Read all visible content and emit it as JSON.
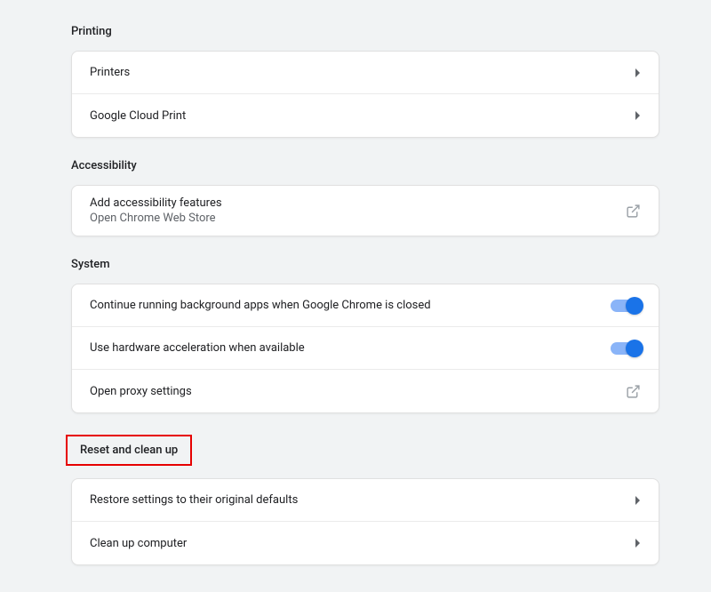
{
  "printing": {
    "title": "Printing",
    "items": [
      {
        "label": "Printers"
      },
      {
        "label": "Google Cloud Print"
      }
    ]
  },
  "accessibility": {
    "title": "Accessibility",
    "items": [
      {
        "label": "Add accessibility features",
        "sublabel": "Open Chrome Web Store"
      }
    ]
  },
  "system": {
    "title": "System",
    "items": [
      {
        "label": "Continue running background apps when Google Chrome is closed"
      },
      {
        "label": "Use hardware acceleration when available"
      },
      {
        "label": "Open proxy settings"
      }
    ]
  },
  "reset": {
    "title": "Reset and clean up",
    "items": [
      {
        "label": "Restore settings to their original defaults"
      },
      {
        "label": "Clean up computer"
      }
    ]
  }
}
